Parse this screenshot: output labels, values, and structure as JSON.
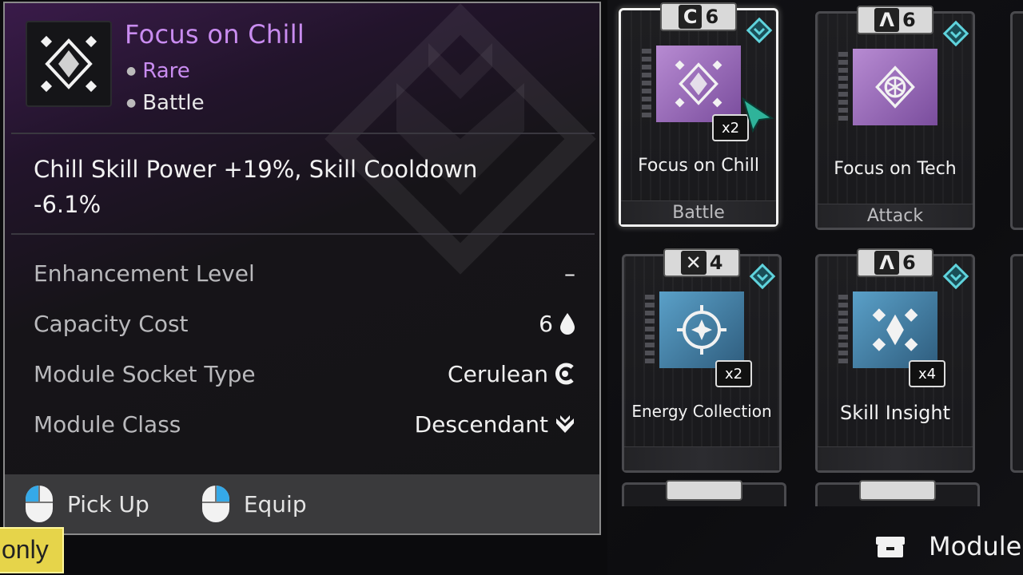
{
  "tooltip": {
    "title": "Focus on Chill",
    "rarity": "Rare",
    "tag": "Battle",
    "description": "Chill Skill Power +19%, Skill Cooldown -6.1%",
    "stats": [
      {
        "label": "Enhancement Level",
        "value": "–"
      },
      {
        "label": "Capacity Cost",
        "value": "6",
        "icon": "drop-icon"
      },
      {
        "label": "Module Socket Type",
        "value": "Cerulean",
        "icon": "cerulean-socket-icon"
      },
      {
        "label": "Module Class",
        "value": "Descendant",
        "icon": "descendant-class-icon"
      }
    ],
    "actions": [
      {
        "label": "Pick Up",
        "icon": "mouse-left-icon"
      },
      {
        "label": "Equip",
        "icon": "mouse-right-icon"
      }
    ],
    "colors": {
      "title": "#c98cf0",
      "rarity": "#c98cf0"
    }
  },
  "modules": [
    {
      "name": "Focus on Chill",
      "cost": "6",
      "socket_icon": "cerulean",
      "count": "x2",
      "socket_label": "Battle",
      "tier": "purple",
      "selected": true
    },
    {
      "name": "Focus on Tech",
      "cost": "6",
      "socket_icon": "almandine",
      "count": "",
      "socket_label": "Attack",
      "tier": "purple",
      "selected": false
    },
    {
      "name": "Energy Collection",
      "cost": "4",
      "socket_icon": "xantic",
      "count": "x2",
      "socket_label": "",
      "tier": "blue",
      "selected": false
    },
    {
      "name": "Skill Insight",
      "cost": "6",
      "socket_icon": "almandine",
      "count": "x4",
      "socket_label": "",
      "tier": "blue",
      "selected": false
    }
  ],
  "bottom": {
    "filter_label": "only",
    "module_label": "Module"
  }
}
